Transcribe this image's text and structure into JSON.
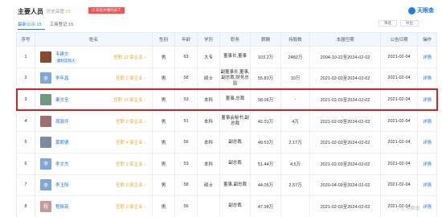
{
  "header": {
    "title": "主要人员",
    "history_label": "历史高管",
    "history_count": "10",
    "notice": "☑ 知名并重的员工",
    "logo": "天眼查"
  },
  "tabs": [
    {
      "label": "最新公示 15",
      "active": true
    },
    {
      "label": "工商登记 15",
      "active": false
    }
  ],
  "actions": {
    "filter": "筛选",
    "export": "导出"
  },
  "columns": [
    "序号",
    "姓名",
    "性别",
    "年龄",
    "学历",
    "职务",
    "薪酬",
    "持股数",
    "本届任期",
    "公告日期",
    "操作"
  ],
  "rows": [
    {
      "no": "1",
      "name": "韦建文",
      "badge": "康利实际人",
      "tenure": "任职 12 家企业",
      "gender": "男",
      "age": "63",
      "edu": "大专",
      "position": "董事长,董事",
      "salary": "103.2万",
      "shares": "2482万",
      "term": "2004-10-22至2024-02-02",
      "date": "2021-02-04",
      "op": "详情",
      "avatar_text": "",
      "avatar_color": "#8a4a2e"
    },
    {
      "no": "2",
      "name": "李年昌",
      "badge": "",
      "tenure": "任职 2 家企业",
      "gender": "男",
      "age": "58",
      "edu": "硕士",
      "position": "副董事长,董事,副总裁,财务总监",
      "salary": "55.83万",
      "shares": "10万",
      "term": "2021-02-03至2024-02-02",
      "date": "2021-02-04",
      "op": "详情",
      "avatar_text": "李",
      "avatar_color": "#7fa6d8"
    },
    {
      "no": "3",
      "name": "秦文全",
      "badge": "",
      "tenure": "任职 15 家企业",
      "gender": "男",
      "age": "53",
      "edu": "本科",
      "position": "董事,总裁",
      "salary": "58.08万",
      "shares": "-",
      "term": "2021-02-03至2024-02-02",
      "date": "2021-02-04",
      "op": "详情",
      "avatar_text": "",
      "avatar_color": "#6f9a7f"
    },
    {
      "no": "4",
      "name": "周敦坪",
      "badge": "",
      "tenure": "任职 2 家企业",
      "gender": "男",
      "age": "51",
      "edu": "本科",
      "position": "董事会秘书,副总裁",
      "salary": "42.01万",
      "shares": "4万",
      "term": "2021-02-03至2024-02-02",
      "date": "2021-02-04",
      "op": "详情",
      "avatar_text": "",
      "avatar_color": "#a07070"
    },
    {
      "no": "5",
      "name": "黄朝德",
      "badge": "",
      "tenure": "任职 4 家企业",
      "gender": "男",
      "age": "56",
      "edu": "本科",
      "position": "副总裁",
      "salary": "49.53万",
      "shares": "2.17万",
      "term": "2021-02-03至2024-02-02",
      "date": "2021-02-04",
      "op": "详情",
      "avatar_text": "",
      "avatar_color": "#7b8a9c"
    },
    {
      "no": "6",
      "name": "李文杰",
      "badge": "",
      "tenure": "任职 2 家企业",
      "gender": "男",
      "age": "53",
      "edu": "本科",
      "position": "副总裁",
      "salary": "51.44万",
      "shares": "4.5万",
      "term": "2021-02-03至2024-02-02",
      "date": "2021-02-04",
      "op": "详情",
      "avatar_text": "李",
      "avatar_color": "#7fa6d8"
    },
    {
      "no": "7",
      "name": "李玉阳",
      "badge": "",
      "tenure": "任职 3 家企业",
      "gender": "男",
      "age": "58",
      "edu": "硕士",
      "position": "董事,副总裁",
      "salary": "44.05万",
      "shares": "2.57万",
      "term": "2020-04-09至2024-02-02",
      "date": "2021-02-04",
      "op": "详情",
      "avatar_text": "李",
      "avatar_color": "#7ba8d4"
    },
    {
      "no": "8",
      "name": "程振亮",
      "badge": "",
      "tenure": "任职 2 家企业",
      "gender": "男",
      "age": "56",
      "edu": "",
      "position": "副总裁",
      "salary": "47.98万",
      "shares": "",
      "term": "2021-02-03至2024-02-02",
      "date": "2021-02-04",
      "op": "详情",
      "avatar_text": "程",
      "avatar_color": "#c69a9a"
    }
  ],
  "watermark": "◎ 天眼查"
}
